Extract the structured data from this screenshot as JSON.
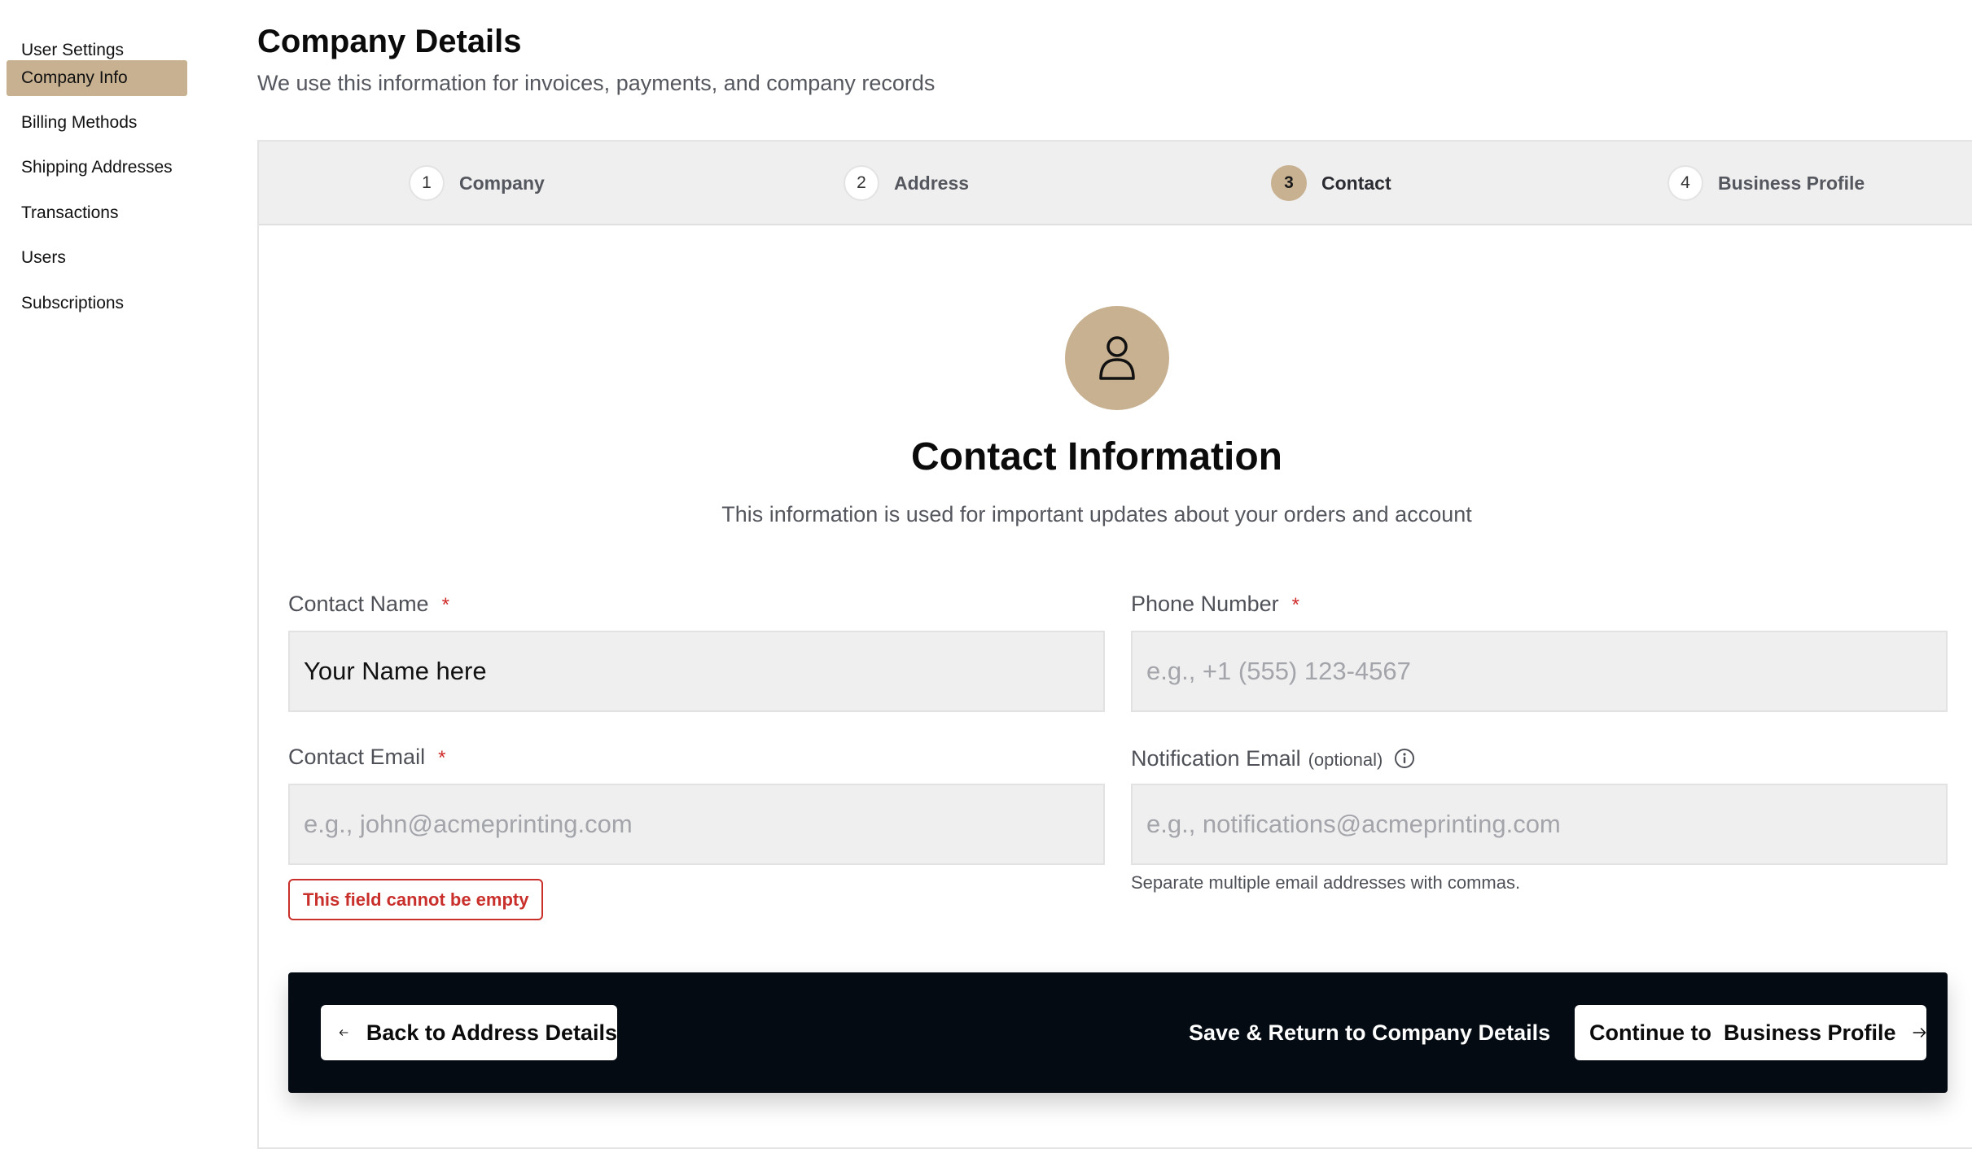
{
  "sidebar": {
    "items": [
      {
        "label": "User Settings",
        "active": false
      },
      {
        "label": "Company Info",
        "active": true
      },
      {
        "label": "Billing Methods",
        "active": false
      },
      {
        "label": "Shipping Addresses",
        "active": false
      },
      {
        "label": "Transactions",
        "active": false
      },
      {
        "label": "Users",
        "active": false
      },
      {
        "label": "Subscriptions",
        "active": false
      }
    ]
  },
  "header": {
    "title": "Company Details",
    "subtitle": "We use this information for invoices, payments, and company records"
  },
  "stepper": {
    "current_step": 3,
    "steps": [
      {
        "number": "1",
        "label": "Company"
      },
      {
        "number": "2",
        "label": "Address"
      },
      {
        "number": "3",
        "label": "Contact"
      },
      {
        "number": "4",
        "label": "Business Profile"
      }
    ]
  },
  "section": {
    "icon": "user-icon",
    "title": "Contact Information",
    "subtitle": "This information is used for important updates about your orders and account"
  },
  "form": {
    "contact_name": {
      "label": "Contact Name",
      "required_mark": "*",
      "value": "Your Name here",
      "placeholder": ""
    },
    "phone_number": {
      "label": "Phone Number",
      "required_mark": "*",
      "value": "",
      "placeholder": "e.g., +1 (555) 123-4567"
    },
    "contact_email": {
      "label": "Contact Email",
      "required_mark": "*",
      "value": "",
      "placeholder": "e.g., john@acmeprinting.com",
      "error": "This field cannot be empty"
    },
    "notification_email": {
      "label": "Notification Email",
      "optional_tag": "(optional)",
      "value": "",
      "placeholder": "e.g., notifications@acmeprinting.com",
      "helper": "Separate multiple email addresses with commas.",
      "info_icon": "info-icon"
    }
  },
  "actions": {
    "back_label": "Back to Address Details",
    "save_label": "Save & Return to Company Details",
    "continue_label": "Continue to  Business Profile"
  },
  "colors": {
    "accent": "#c8b191",
    "error": "#c9302c",
    "action_bar": "#040b12",
    "input_bg": "#efefef"
  }
}
